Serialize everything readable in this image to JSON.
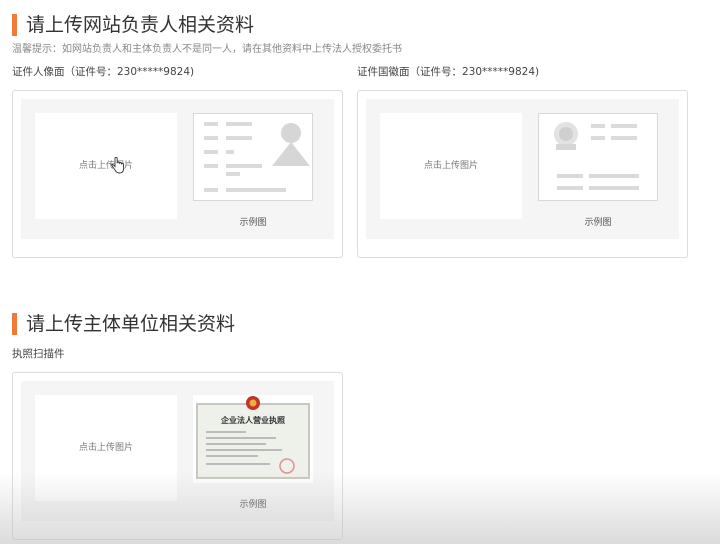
{
  "section1": {
    "title": "请上传网站负责人相关资料",
    "hint": "温馨提示：如网站负责人和主体负责人不是同一人，请在其他资料中上传法人授权委托书",
    "portrait": {
      "label": "证件人像面（证件号：230*****9824)",
      "upload_text": "点击上传图片",
      "sample_caption": "示例图"
    },
    "emblem": {
      "label": "证件国徽面（证件号：230*****9824)",
      "upload_text": "点击上传图片",
      "sample_caption": "示例图"
    }
  },
  "section2": {
    "title": "请上传主体单位相关资料",
    "license": {
      "label": "执照扫描件",
      "upload_text": "点击上传图片",
      "sample_caption": "示例图",
      "sample_heading": "企业法人营业执照"
    }
  },
  "colors": {
    "accent": "#f07a3c",
    "panel": "#f5f5f5",
    "border": "#dcdcdc"
  }
}
